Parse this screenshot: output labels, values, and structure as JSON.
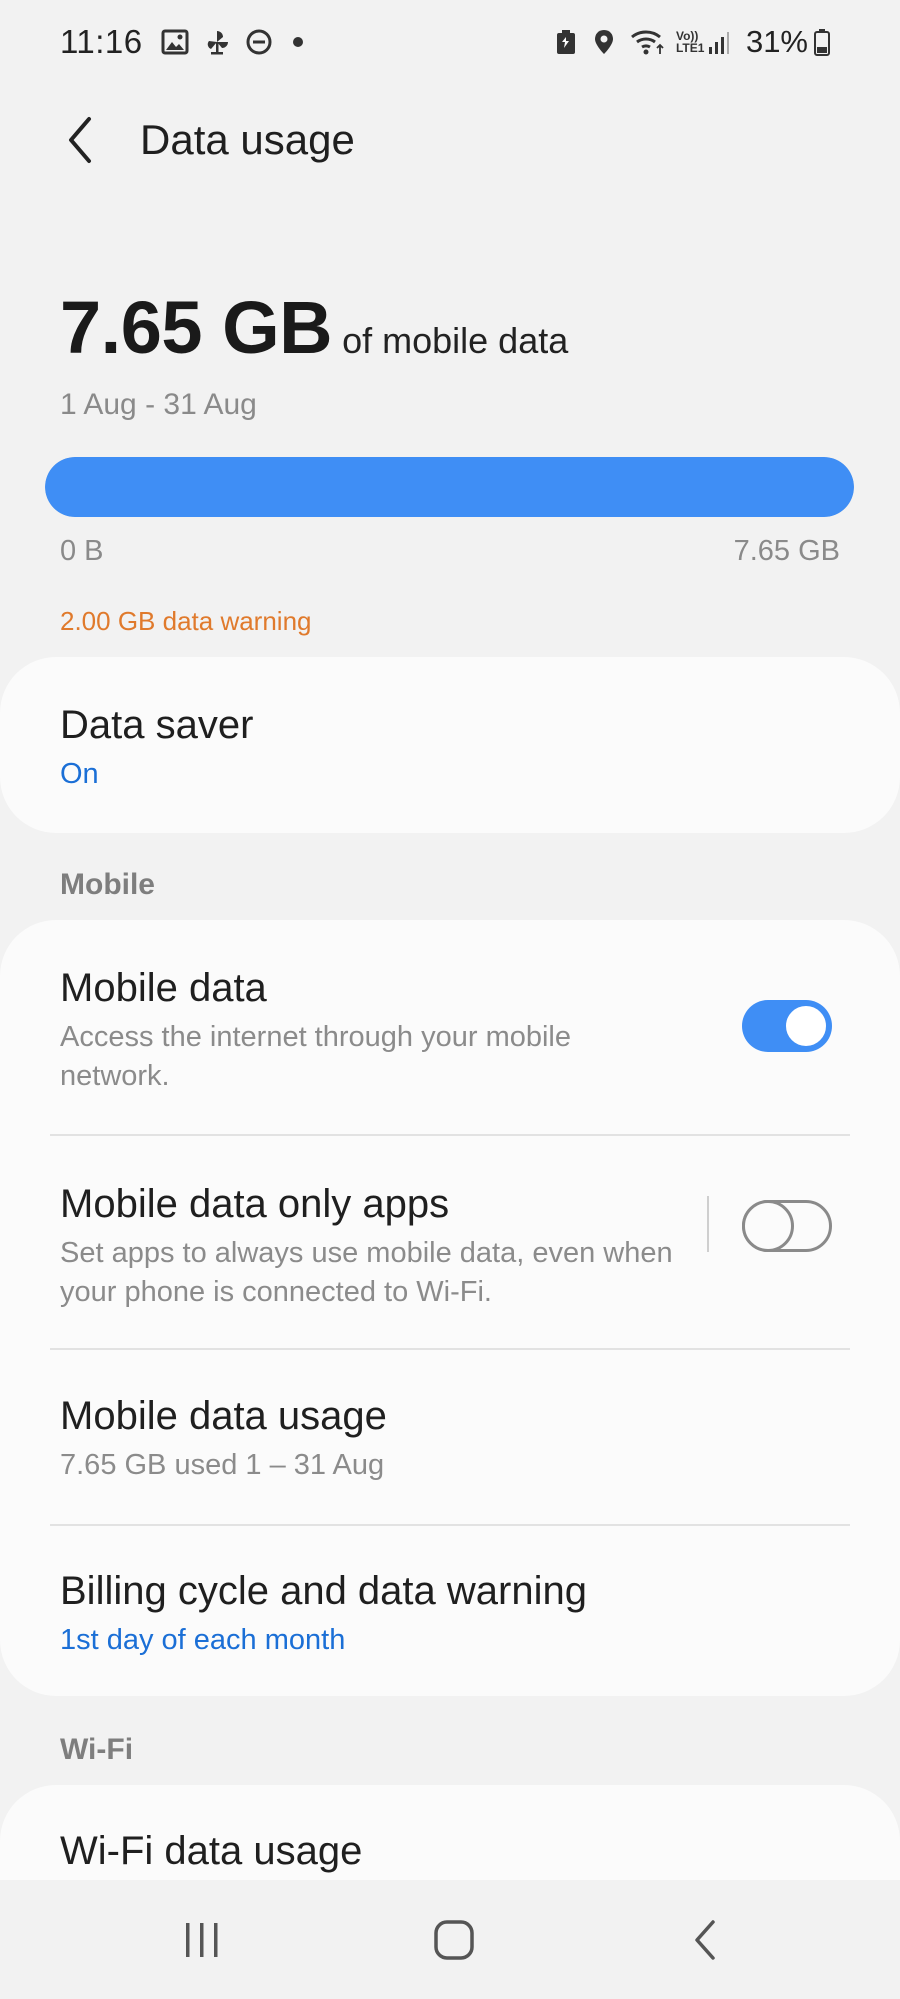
{
  "status_bar": {
    "time": "11:16",
    "battery": "31%",
    "left_icons": [
      "image-icon",
      "pinwheel-icon",
      "do-not-disturb-icon",
      "dot-icon"
    ],
    "right_icons": [
      "battery-saver-icon",
      "location-icon",
      "wifi-icon",
      "volte-signal-icon",
      "battery-icon"
    ],
    "volte_label": "Vo))",
    "lte_label": "LTE1"
  },
  "header": {
    "back_icon": "chevron-left-icon",
    "title": "Data usage"
  },
  "usage": {
    "amount": "7.65 GB",
    "suffix": "of mobile data",
    "period": "1 Aug - 31 Aug",
    "bar_fill_percent": 100,
    "bar_min_label": "0 B",
    "bar_max_label": "7.65 GB",
    "warning": "2.00 GB data warning",
    "accent_color": "#3f8ef5",
    "warning_color": "#e07a2c"
  },
  "data_saver": {
    "title": "Data saver",
    "status": "On"
  },
  "mobile_section": {
    "label": "Mobile",
    "items": [
      {
        "title": "Mobile data",
        "subtitle": "Access the internet through your mobile network.",
        "toggle": true
      },
      {
        "title": "Mobile data only apps",
        "subtitle": "Set apps to always use mobile data, even when your phone is connected to Wi-Fi.",
        "toggle": false
      },
      {
        "title": "Mobile data usage",
        "subtitle": "7.65 GB used 1 – 31 Aug"
      },
      {
        "title": "Billing cycle and data warning",
        "subtitle": "1st day of each month"
      }
    ]
  },
  "wifi_section": {
    "label": "Wi-Fi",
    "items": [
      {
        "title": "Wi-Fi data usage"
      }
    ]
  },
  "nav_bar": {
    "buttons": [
      "recents-icon",
      "home-icon",
      "back-icon"
    ]
  }
}
